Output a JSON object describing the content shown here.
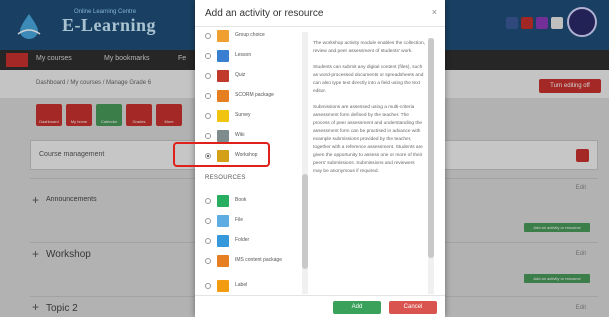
{
  "site": {
    "logo_tagline": "Online Learning Centre",
    "logo_name": "E-Learning"
  },
  "nav": {
    "items": [
      "My courses",
      "My bookmarks",
      "Fe"
    ]
  },
  "breadcrumb": "Dashboard / My courses / Manage Grade 6",
  "turn_editing": "Turn editing off",
  "tiles": [
    {
      "label": "Dashboard",
      "color": "#c8332f"
    },
    {
      "label": "My home",
      "color": "#c8332f"
    },
    {
      "label": "Calendar",
      "color": "#4a9a5a"
    },
    {
      "label": "Grades",
      "color": "#c8332f"
    },
    {
      "label": "More",
      "color": "#c8332f"
    }
  ],
  "course_card": "Course management",
  "sections": [
    {
      "title": "Announcements",
      "edit": "Edit",
      "add": "Add an activity or resource"
    },
    {
      "title": "Workshop",
      "edit": "Edit",
      "add": "Add an activity or resource"
    },
    {
      "title": "Topic 2",
      "edit": "Edit",
      "add": "Add an activity or resource"
    }
  ],
  "modal": {
    "title": "Add an activity or resource",
    "close": "×",
    "activities": [
      {
        "label": "Group choice",
        "icon": "group-choice-icon",
        "color": "#f0a030",
        "selected": false
      },
      {
        "label": "Lesson",
        "icon": "lesson-icon",
        "color": "#3a7fd0",
        "selected": false
      },
      {
        "label": "Quiz",
        "icon": "quiz-icon",
        "color": "#c0392b",
        "selected": false
      },
      {
        "label": "SCORM package",
        "icon": "scorm-icon",
        "color": "#e67e22",
        "selected": false
      },
      {
        "label": "Survey",
        "icon": "survey-icon",
        "color": "#f1c40f",
        "selected": false
      },
      {
        "label": "Wiki",
        "icon": "wiki-icon",
        "color": "#7f8c8d",
        "selected": false
      },
      {
        "label": "Workshop",
        "icon": "workshop-icon",
        "color": "#d4a017",
        "selected": true
      }
    ],
    "resources_heading": "RESOURCES",
    "resources": [
      {
        "label": "Book",
        "icon": "book-icon",
        "color": "#27ae60"
      },
      {
        "label": "File",
        "icon": "file-icon",
        "color": "#5dade2"
      },
      {
        "label": "Folder",
        "icon": "folder-icon",
        "color": "#3498db"
      },
      {
        "label": "IMS content package",
        "icon": "ims-package-icon",
        "color": "#e67e22"
      },
      {
        "label": "Label",
        "icon": "label-icon",
        "color": "#f39c12"
      }
    ],
    "description": [
      "The workshop activity module enables the collection, review and peer assessment of students' work.",
      "Students can submit any digital content (files), such as word-processed documents or spreadsheets and can also type text directly into a field using the text editor.",
      "Submissions are assessed using a multi-criteria assessment form defined by the teacher. The process of peer assessment and understanding the assessment form can be practised in advance with example submissions provided by the teacher, together with a reference assessment. Students are given the opportunity to assess one or more of their peers' submissions. Submissions and reviewers may be anonymous if required."
    ],
    "add_button": "Add",
    "cancel_button": "Cancel"
  }
}
